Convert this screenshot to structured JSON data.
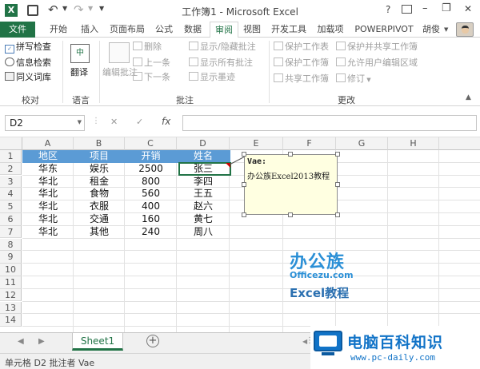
{
  "window": {
    "title": "工作簿1 - Microsoft Excel",
    "help": "?",
    "minimize": "–",
    "restore": "❐",
    "close": "✕"
  },
  "tabs": {
    "file": "文件",
    "home": "开始",
    "insert": "插入",
    "layout": "页面布局",
    "formulas": "公式",
    "data": "数据",
    "review": "审阅",
    "view": "视图",
    "developer": "开发工具",
    "addins": "加载项",
    "powerpivot": "POWERPIVOT",
    "user": "胡俊"
  },
  "ribbon": {
    "spell": "拼写检查",
    "research": "信息检索",
    "thesaurus": "同义词库",
    "proofing": "校对",
    "translate": "翻译",
    "language": "语言",
    "edit_comment": "编辑批注",
    "delete": "删除",
    "previous": "上一条",
    "next": "下一条",
    "show_hide": "显示/隐藏批注",
    "show_all": "显示所有批注",
    "show_ink": "显示墨迹",
    "comments": "批注",
    "protect_sheet": "保护工作表",
    "protect_workbook": "保护工作簿",
    "share_workbook": "共享工作簿",
    "protect_share": "保护并共享工作簿",
    "allow_edit": "允许用户编辑区域",
    "track": "修订",
    "changes": "更改"
  },
  "formula": {
    "namebox": "D2",
    "cancel": "✕",
    "enter": "✓",
    "fx": "fx",
    "value": ""
  },
  "columns": [
    "A",
    "B",
    "C",
    "D",
    "E",
    "F",
    "G",
    "H"
  ],
  "rows": [
    "1",
    "2",
    "3",
    "4",
    "5",
    "6",
    "7",
    "8",
    "9",
    "10",
    "11",
    "12",
    "13",
    "14"
  ],
  "headers": [
    "地区",
    "项目",
    "开销",
    "姓名"
  ],
  "data": [
    [
      "华东",
      "娱乐",
      "2500",
      "张三"
    ],
    [
      "华北",
      "租金",
      "800",
      "李四"
    ],
    [
      "华北",
      "食物",
      "560",
      "王五"
    ],
    [
      "华北",
      "衣服",
      "400",
      "赵六"
    ],
    [
      "华北",
      "交通",
      "160",
      "黄七"
    ],
    [
      "华北",
      "其他",
      "240",
      "周八"
    ]
  ],
  "comment": {
    "author": "Vae:",
    "text": "办公族Excel2013教程"
  },
  "watermark": {
    "brand_cn": "办公族",
    "brand_url": "Officezu.com",
    "brand_sub": "Excel教程"
  },
  "sheets": {
    "active": "Sheet1",
    "add": "+"
  },
  "status": {
    "text": "单元格 D2 批注者 Vae"
  },
  "logo": {
    "name": "电脑百科知识",
    "url": "www.pc-daily.com"
  },
  "colors": {
    "excel_green": "#217346",
    "header_blue": "#5b9bd5",
    "comment_bg": "#ffffe1"
  }
}
